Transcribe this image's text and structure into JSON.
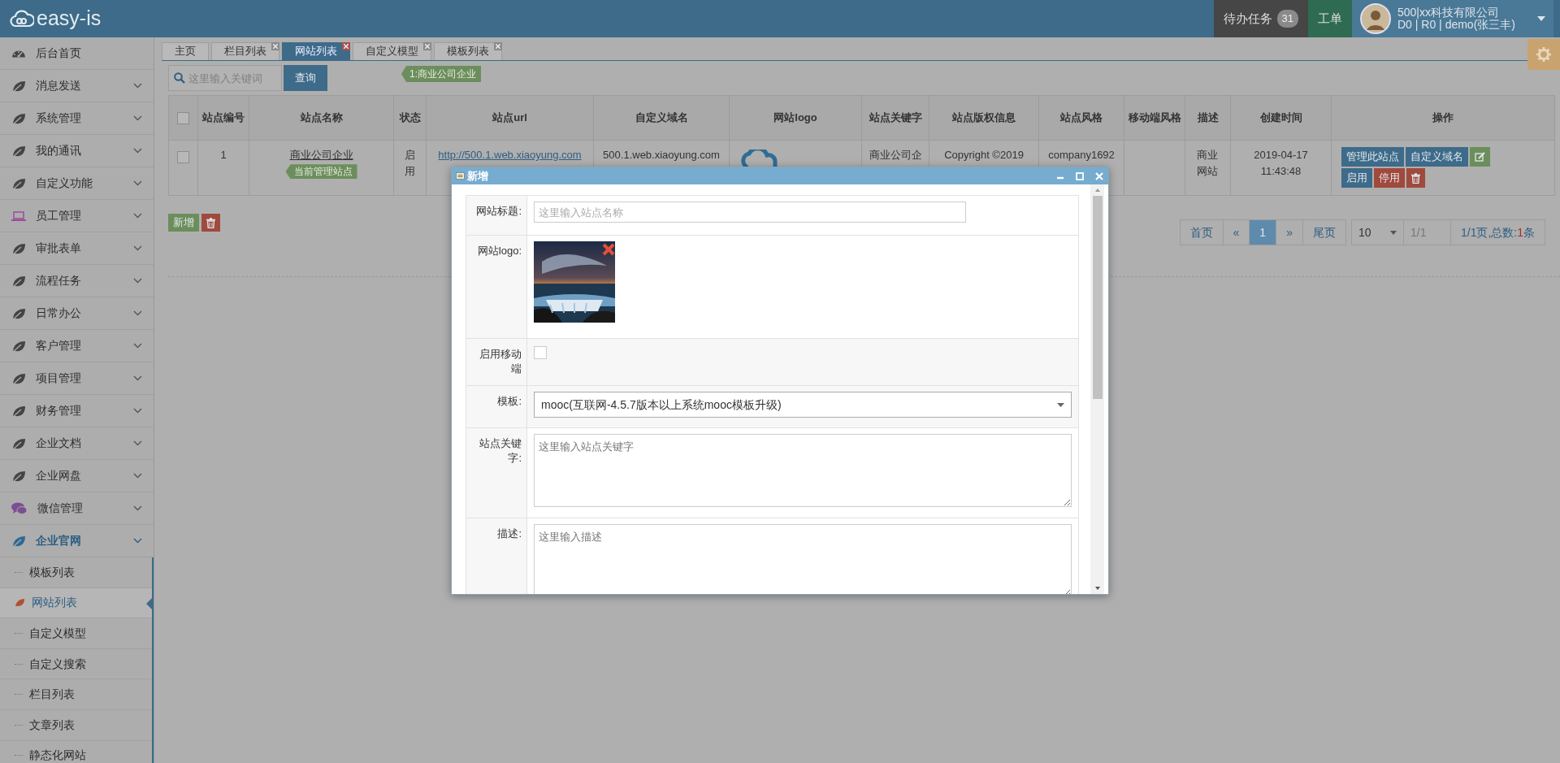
{
  "header": {
    "logo": "easy-is",
    "tasks": {
      "label": "待办任务",
      "count": "31"
    },
    "tickets": "工单",
    "user": {
      "company": "500|xx科技有限公司",
      "account": "D0 | R0 | demo(张三丰)"
    }
  },
  "sidebar": {
    "items": [
      {
        "label": "后台首页"
      },
      {
        "label": "消息发送",
        "expanded": false
      },
      {
        "label": "系统管理",
        "expanded": false
      },
      {
        "label": "我的通讯",
        "expanded": false
      },
      {
        "label": "自定义功能",
        "expanded": false
      },
      {
        "label": "员工管理",
        "expanded": false
      },
      {
        "label": "审批表单",
        "expanded": false
      },
      {
        "label": "流程任务",
        "expanded": false
      },
      {
        "label": "日常办公",
        "expanded": false
      },
      {
        "label": "客户管理",
        "expanded": false
      },
      {
        "label": "项目管理",
        "expanded": false
      },
      {
        "label": "财务管理",
        "expanded": false
      },
      {
        "label": "企业文档",
        "expanded": false
      },
      {
        "label": "企业网盘",
        "expanded": false
      },
      {
        "label": "微信管理",
        "expanded": false
      },
      {
        "label": "企业官网",
        "expanded": true,
        "children": [
          {
            "label": "模板列表",
            "selected": false
          },
          {
            "label": "网站列表",
            "selected": true
          },
          {
            "label": "自定义模型",
            "selected": false
          },
          {
            "label": "自定义搜索",
            "selected": false
          },
          {
            "label": "栏目列表",
            "selected": false
          },
          {
            "label": "文章列表",
            "selected": false
          },
          {
            "label": "静态化网站",
            "selected": false
          }
        ]
      }
    ]
  },
  "tabs": [
    {
      "label": "主页",
      "selected": false,
      "closable": false
    },
    {
      "label": "栏目列表",
      "selected": false,
      "closable": true
    },
    {
      "label": "网站列表",
      "selected": true,
      "closable": true
    },
    {
      "label": "自定义模型",
      "selected": false,
      "closable": true
    },
    {
      "label": "模板列表",
      "selected": false,
      "closable": true
    }
  ],
  "search": {
    "placeholder": "这里输入关键词",
    "button": "查询",
    "current_site": "1:商业公司企业"
  },
  "table": {
    "select_all": {
      "checked": false
    },
    "columns": [
      "站点编号",
      "站点名称",
      "状态",
      "站点url",
      "自定义域名",
      "网站logo",
      "站点关键字",
      "站点版权信息",
      "站点风格",
      "移动端风格",
      "描述",
      "创建时间",
      "操作"
    ],
    "rows": [
      {
        "checked": false,
        "id": "1",
        "name": "商业公司企业",
        "tag": "当前管理站点",
        "status": "启用",
        "url": "http://500.1.web.xiaoyung.com",
        "domain": "500.1.web.xiaoyung.com",
        "keywords": "商业公司企",
        "copyright": "Copyright ©2019",
        "style": "company1692",
        "description": "商业网站",
        "created": "2019-04-17 11:43:48",
        "actions": [
          {
            "kind": "action",
            "label": "管理此站点"
          },
          {
            "kind": "action",
            "label": "自定义域名"
          },
          {
            "kind": "edit"
          },
          {
            "kind": "action",
            "label": "启用"
          },
          {
            "kind": "disable",
            "label": "停用"
          },
          {
            "kind": "delete"
          }
        ]
      }
    ]
  },
  "toolbar": [
    {
      "kind": "add",
      "label": "新增"
    },
    {
      "kind": "delete"
    }
  ],
  "pagination": {
    "first": "首页",
    "prev": "«",
    "pages": [
      {
        "label": "1",
        "selected": true
      }
    ],
    "next": "»",
    "last": "尾页",
    "page_size": "10",
    "page_placeholder": "1/1",
    "summary": "1/1页,总数:",
    "total": "1",
    "unit": "条"
  },
  "modal": {
    "title": "新增",
    "fields": [
      {
        "kind": "input",
        "label": "网站标题:",
        "placeholder": "这里输入站点名称"
      },
      {
        "label": "网站logo:"
      },
      {
        "kind": "checkbox",
        "label": "启用移动端",
        "checked": false
      },
      {
        "kind": "select",
        "label": "模板:",
        "value": "mooc(互联网-4.5.7版本以上系统mooc模板升级)"
      },
      {
        "kind": "textarea",
        "label": "站点关键字:",
        "placeholder": "这里输入站点关键字"
      },
      {
        "kind": "textarea",
        "label": "描述:",
        "placeholder": "这里输入描述"
      }
    ]
  }
}
